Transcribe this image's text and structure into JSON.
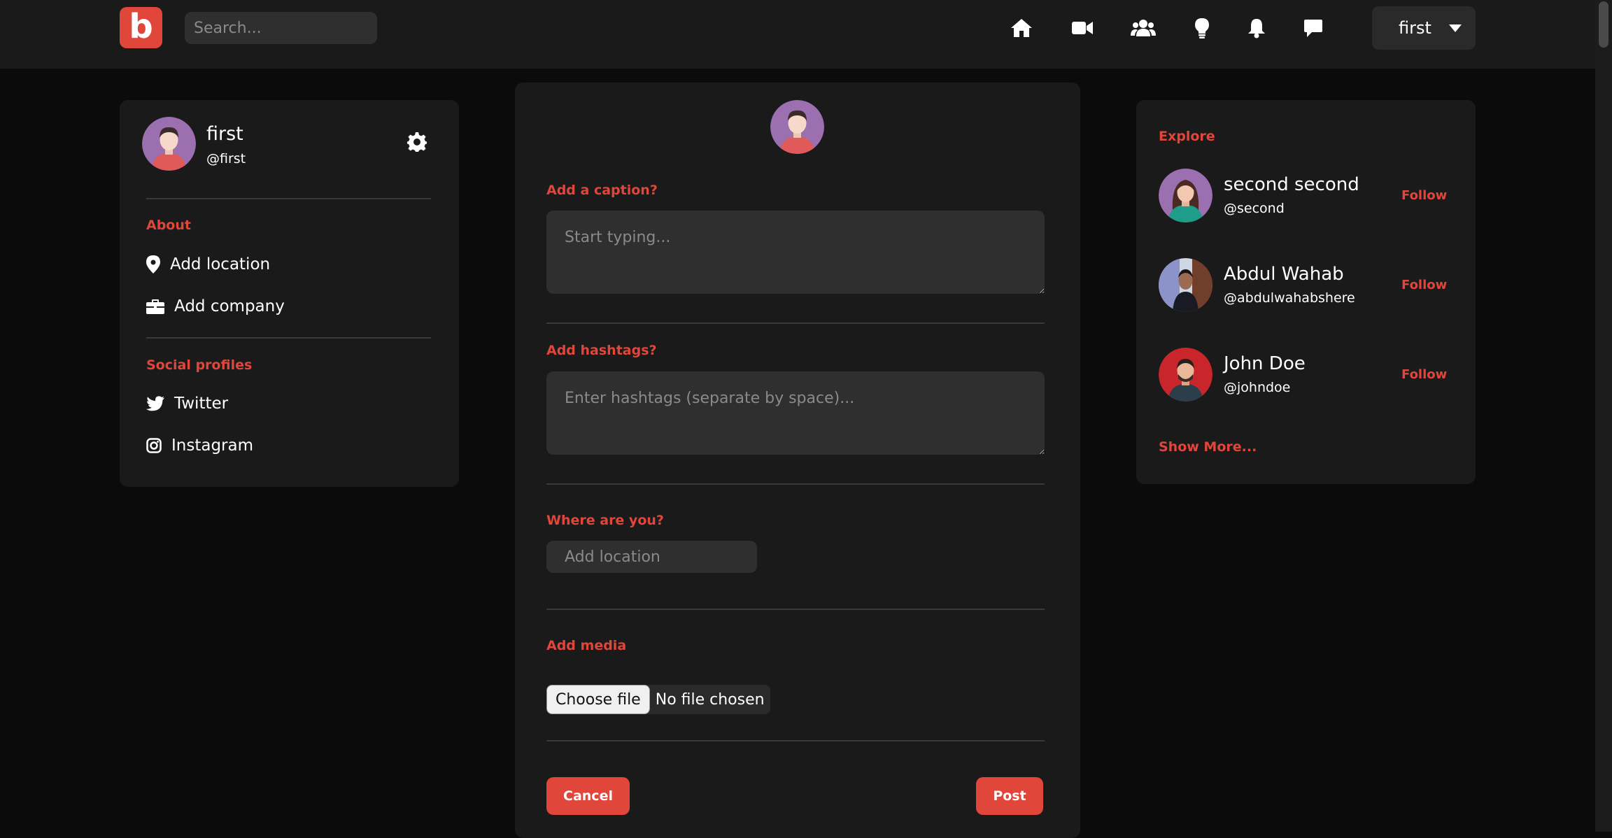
{
  "app": {
    "logo_letter": "b",
    "brand_color": "#e0463a"
  },
  "header": {
    "search_placeholder": "Search...",
    "nav_icons": [
      "home-icon",
      "video-icon",
      "users-icon",
      "lightbulb-icon",
      "bell-icon",
      "chat-icon"
    ],
    "user_menu": {
      "name": "first"
    }
  },
  "profile": {
    "name": "first",
    "handle": "@first",
    "about_title": "About",
    "about_items": [
      {
        "icon": "location-pin-icon",
        "label": "Add location"
      },
      {
        "icon": "briefcase-icon",
        "label": "Add company"
      }
    ],
    "social_title": "Social profiles",
    "social_items": [
      {
        "icon": "twitter-icon",
        "label": "Twitter"
      },
      {
        "icon": "instagram-icon",
        "label": "Instagram"
      }
    ]
  },
  "post_form": {
    "caption_label": "Add a caption?",
    "caption_placeholder": "Start typing...",
    "hashtags_label": "Add hashtags?",
    "hashtags_placeholder": "Enter hashtags (separate by space)...",
    "location_label": "Where are you?",
    "location_placeholder": "Add location",
    "media_label": "Add media",
    "file_button": "Choose file",
    "file_status": "No file chosen",
    "cancel_label": "Cancel",
    "post_label": "Post"
  },
  "explore": {
    "title": "Explore",
    "users": [
      {
        "name": "second second",
        "handle": "@second",
        "follow_label": "Follow"
      },
      {
        "name": "Abdul Wahab",
        "handle": "@abdulwahabshere",
        "follow_label": "Follow"
      },
      {
        "name": "John Doe",
        "handle": "@johndoe",
        "follow_label": "Follow"
      }
    ],
    "show_more": "Show More..."
  }
}
